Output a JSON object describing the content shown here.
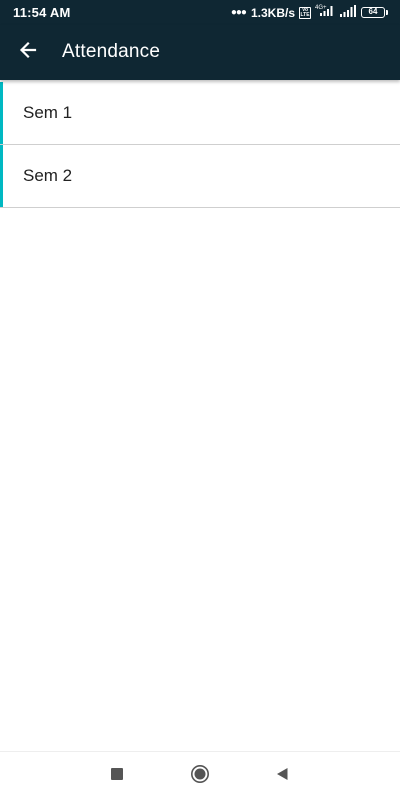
{
  "status_bar": {
    "time": "11:54 AM",
    "network_speed": "1.3KB/s",
    "volte_label": "Vo LTE",
    "network_type": "4G+",
    "battery_level": "64",
    "icons": [
      "more-dots-icon",
      "volte-icon",
      "signal-4g-icon",
      "signal-icon",
      "battery-icon"
    ]
  },
  "app_bar": {
    "title": "Attendance",
    "back_icon": "arrow-left-icon"
  },
  "semesters": [
    {
      "label": "Sem 1"
    },
    {
      "label": "Sem 2"
    }
  ],
  "nav_bar": {
    "icons": [
      "recents-square-icon",
      "home-circle-icon",
      "back-triangle-icon"
    ]
  },
  "colors": {
    "app_bar_background": "#0f2733",
    "accent": "#00b8c2",
    "divider": "#cfcfcf",
    "background": "#ffffff"
  }
}
